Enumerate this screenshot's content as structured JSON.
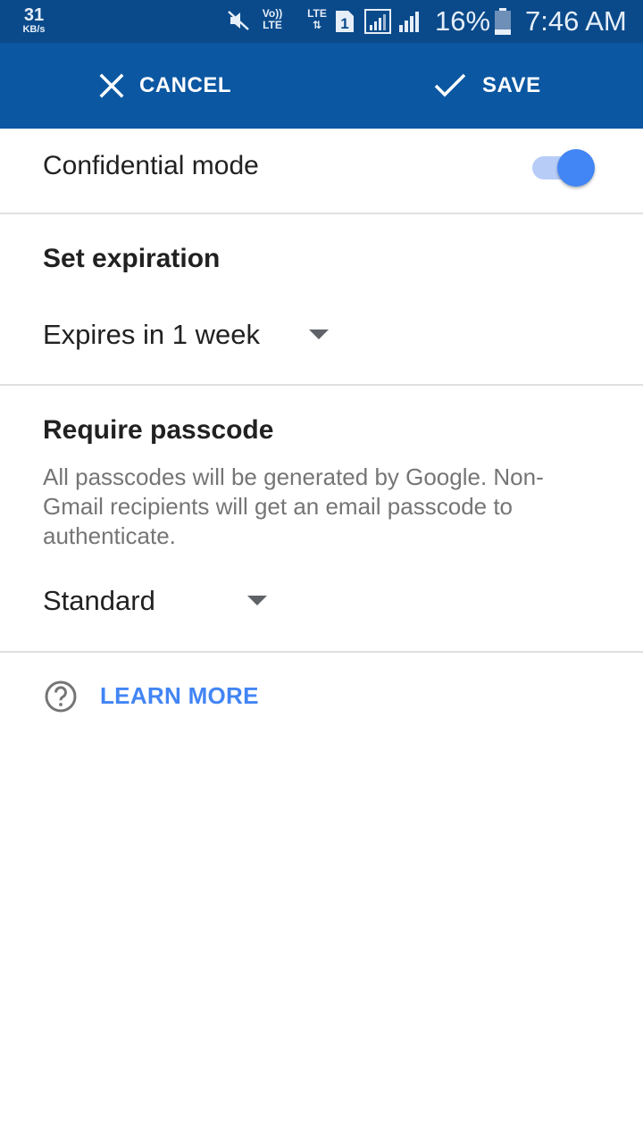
{
  "status_bar": {
    "net_speed_value": "31",
    "net_speed_unit": "KB/s",
    "volte_label": "Vo))\nLTE",
    "lte_label": "LTE",
    "sim_slot": "1",
    "battery_percent": "16%",
    "time": "7:46 AM",
    "icons": [
      "mute-vibrate-icon",
      "volte-icon",
      "lte-data-icon",
      "sim-1-icon",
      "signal-icon",
      "signal-icon",
      "battery-icon"
    ]
  },
  "action_bar": {
    "cancel_label": "CANCEL",
    "save_label": "SAVE",
    "background": "#0b57a2"
  },
  "confidential": {
    "label": "Confidential mode",
    "enabled": true,
    "accent": "#4285f4"
  },
  "expiration": {
    "title": "Set expiration",
    "selected": "Expires in 1 week"
  },
  "passcode": {
    "title": "Require passcode",
    "description": "All passcodes will be generated by Google. Non-Gmail recipients will get an email passcode to authenticate.",
    "selected": "Standard"
  },
  "learn_more": {
    "label": "LEARN MORE",
    "icon": "help-circle-icon"
  }
}
